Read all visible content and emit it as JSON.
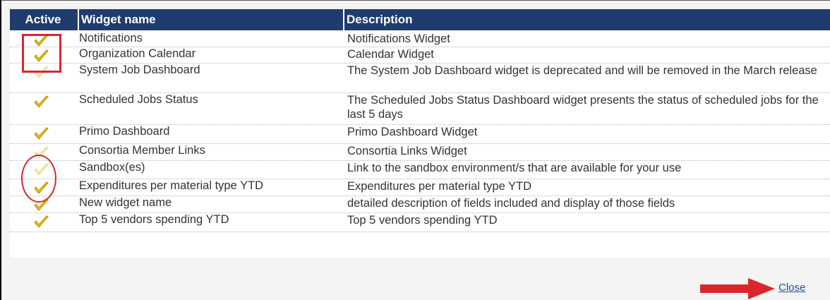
{
  "table": {
    "headers": {
      "active": "Active",
      "name": "Widget name",
      "description": "Description"
    },
    "rows": [
      {
        "active": true,
        "name": "Notifications",
        "description": "Notifications Widget"
      },
      {
        "active": true,
        "name": "Organization Calendar",
        "description": "Calendar Widget"
      },
      {
        "active": false,
        "name": "System Job Dashboard",
        "description": "The System Job Dashboard widget is deprecated and will be removed in the March release"
      },
      {
        "active": true,
        "name": "Scheduled Jobs Status",
        "description": "The Scheduled Jobs Status Dashboard widget presents the status of scheduled jobs for the last 5 days"
      },
      {
        "active": true,
        "name": "Primo Dashboard",
        "description": "Primo Dashboard Widget"
      },
      {
        "active": false,
        "name": "Consortia Member Links",
        "description": "Consortia Links Widget"
      },
      {
        "active": false,
        "name": "Sandbox(es)",
        "description": "Link to the sandbox environment/s that are available for your use"
      },
      {
        "active": true,
        "name": "Expenditures per material type YTD",
        "description": "Expenditures per material type YTD"
      },
      {
        "active": true,
        "name": "New widget name",
        "description": "detailed description of fields included and display of those fields"
      },
      {
        "active": true,
        "name": "Top 5 vendors spending YTD",
        "description": "Top 5 vendors spending YTD"
      }
    ]
  },
  "footer": {
    "close_label": "Close"
  },
  "icons": {
    "active": "checkmark-icon",
    "inactive": "checkmark-faded-icon"
  },
  "colors": {
    "header_bg": "#1f3c6e",
    "check_active": "#f2c21b",
    "check_inactive": "#f7ecb0",
    "annotation": "#d9262c",
    "link": "#1f4ea1"
  }
}
